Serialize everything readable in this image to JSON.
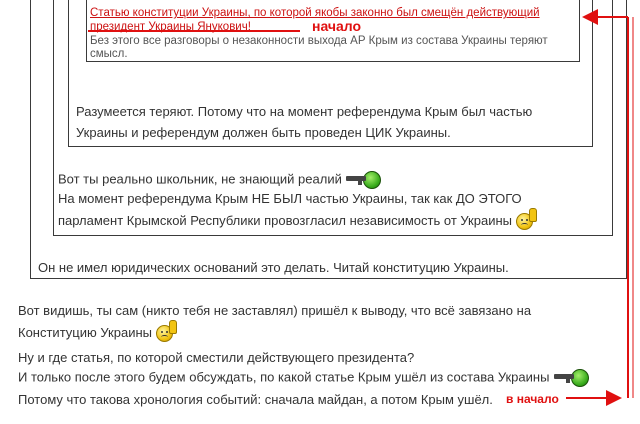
{
  "quote_level4": {
    "line1": "Статью конституции Украины, по которой якобы законно был смещён действующий",
    "line2": "президент Украины Янукович!",
    "line3": "Без этого все разговоры о незаконности выхода АР Крым из состава Украины теряют",
    "line4": "смысл."
  },
  "quote_level3": {
    "line1": "Разумеется теряют. Потому что на момент референдума Крым был частью",
    "line2": "Украины и референдум должен быть проведен ЦИК Украины."
  },
  "quote_level2": {
    "line1": "Вот ты реально школьник, не знающий реалий",
    "line2": "На момент референдума Крым НЕ БЫЛ частью Украины, так как ДО ЭТОГО",
    "line3": "парламент Крымской Республики провозгласил независимость от Украины"
  },
  "quote_level1": {
    "line1": "Он не имел юридических оснований это делать. Читай конституцию Украины."
  },
  "reply": {
    "line1": "Вот видишь, ты сам (никто тебя не заставлял) пришёл к выводу, что всё завязано на",
    "line2": "Конституцию Украины",
    "line3": "Ну и где статья, по которой сместили действующего президента?",
    "line4": "И только после этого будем обсуждать, по какой статье Крым ушёл из состава Украины",
    "line5": "Потому что такова хронология событий: сначала майдан, а потом Крым ушёл."
  },
  "annotations": {
    "start_label": "начало",
    "to_start_label": "в начало",
    "color": "#e01010"
  },
  "icons": [
    "sad-smiley-icon",
    "gun-smiley-icon"
  ]
}
